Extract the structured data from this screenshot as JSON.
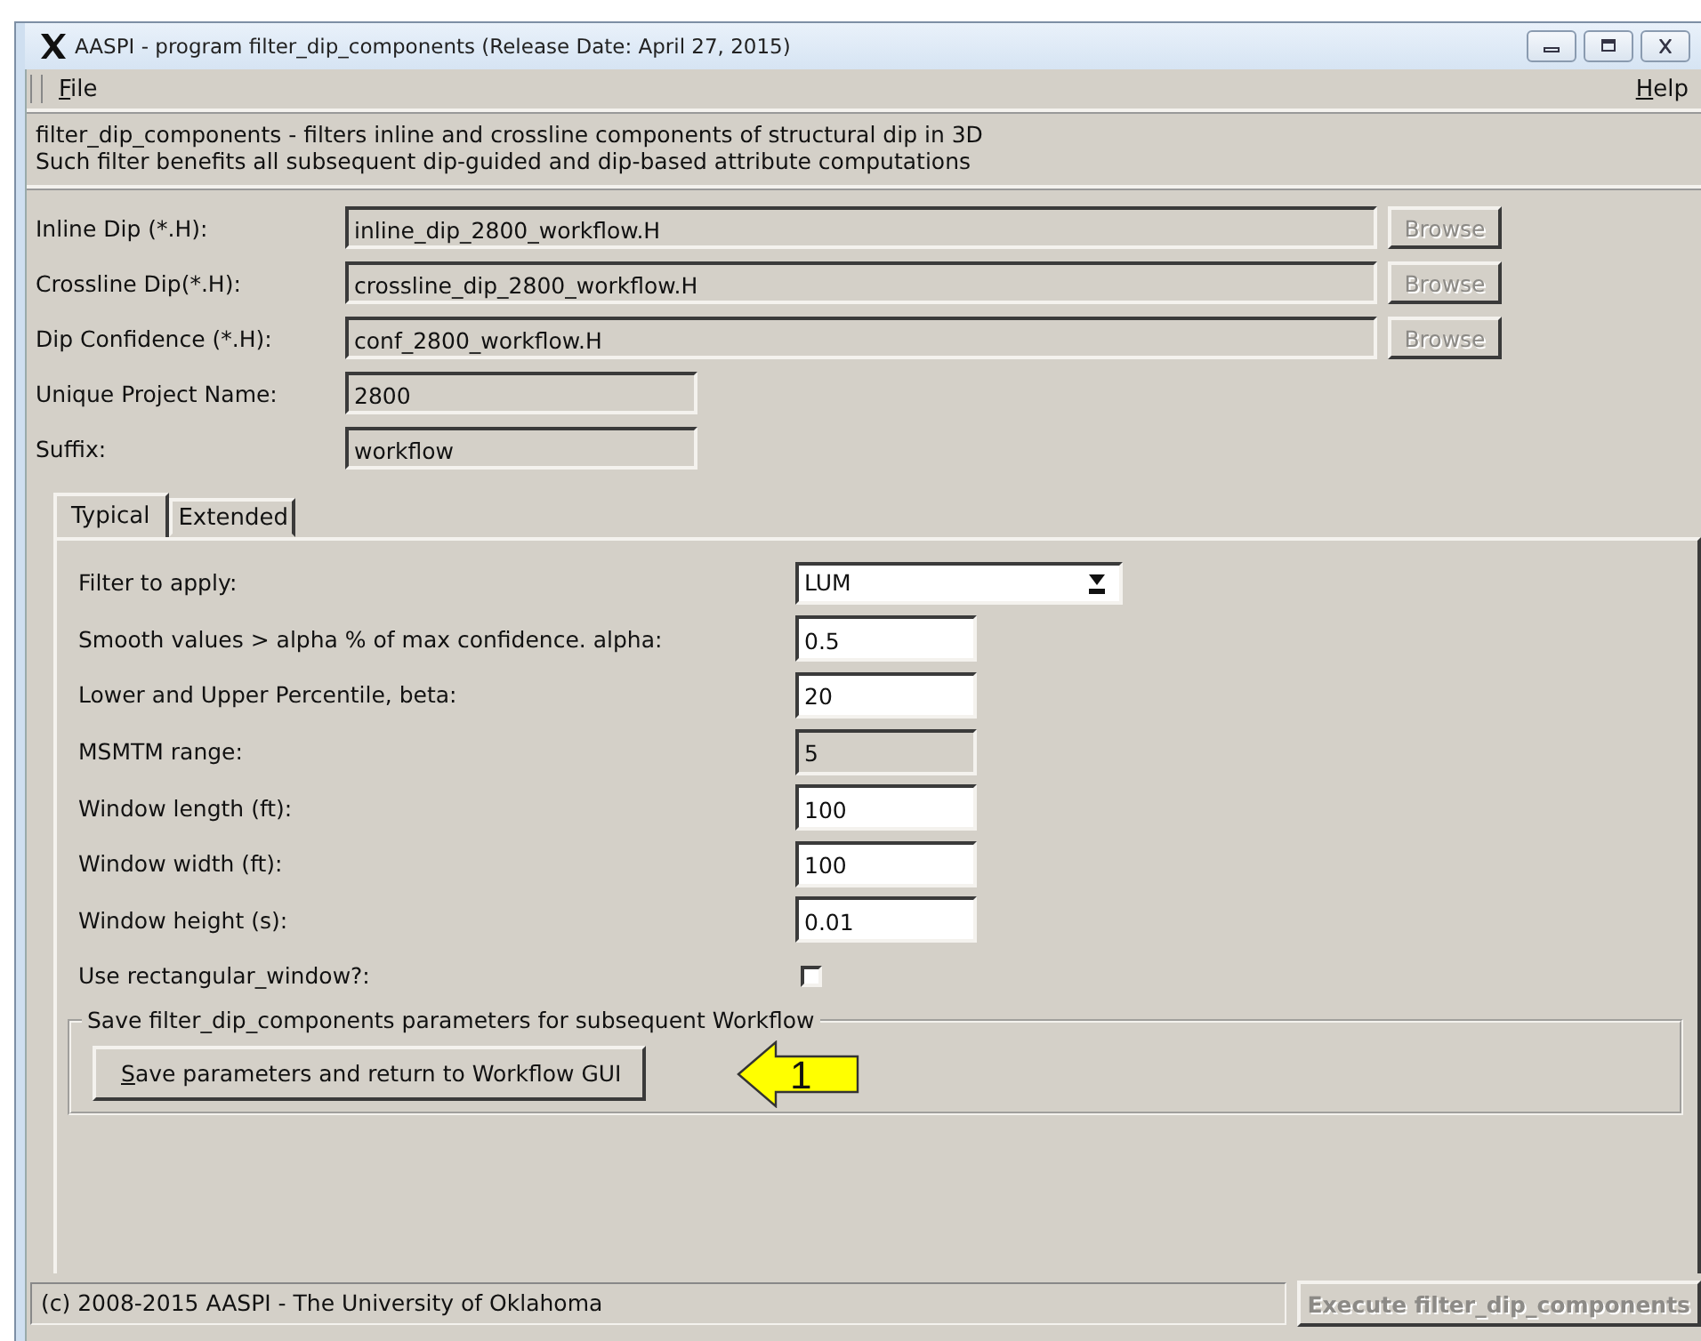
{
  "window": {
    "title": "AASPI - program filter_dip_components (Release Date: April 27, 2015)"
  },
  "menu_left": [
    {
      "label": "File",
      "underline_first": true
    }
  ],
  "menu_right": [
    {
      "label": "Help",
      "underline_first": true
    }
  ],
  "description": [
    "filter_dip_components - filters inline and crossline components of structural dip in 3D",
    "Such filter benefits all subsequent dip-guided and dip-based attribute computations"
  ],
  "files": [
    {
      "label": "Inline Dip (*.H):",
      "value": "inline_dip_2800_workflow.H",
      "button": "Browse",
      "wide": true
    },
    {
      "label": "Crossline Dip(*.H):",
      "value": "crossline_dip_2800_workflow.H",
      "button": "Browse",
      "wide": true
    },
    {
      "label": "Dip Confidence (*.H):",
      "value": "conf_2800_workflow.H",
      "button": "Browse",
      "wide": true
    },
    {
      "label": "Unique Project Name:",
      "value": "2800",
      "wide": false
    },
    {
      "label": "Suffix:",
      "value": "workflow",
      "wide": false
    }
  ],
  "tabs": [
    {
      "label": "Typical",
      "selected": true
    },
    {
      "label": "Extended",
      "selected": false
    }
  ],
  "params": [
    {
      "kind": "dropdown",
      "label": "Filter to apply:",
      "value": "LUM"
    },
    {
      "kind": "entry",
      "label": "Smooth values  > alpha % of max confidence. alpha:",
      "value": "0.5",
      "disabled": false
    },
    {
      "kind": "entry",
      "label": "Lower and Upper Percentile, beta:",
      "value": "20",
      "disabled": false
    },
    {
      "kind": "entry",
      "label": "MSMTM range:",
      "value": "5",
      "disabled": true
    },
    {
      "kind": "entry",
      "label": "Window length (ft):",
      "value": "100",
      "disabled": false
    },
    {
      "kind": "entry",
      "label": "Window width (ft):",
      "value": "100",
      "disabled": false
    },
    {
      "kind": "entry",
      "label": "Window height (s):",
      "value": "0.01",
      "disabled": false
    },
    {
      "kind": "checkbox",
      "label": "Use rectangular_window?:",
      "checked": false
    }
  ],
  "save_group": {
    "title": "Save filter_dip_components parameters for subsequent Workflow",
    "button": "Save parameters and return to Workflow GUI",
    "underline_first": true,
    "annotation": "1"
  },
  "status_bar": {
    "text": "(c) 2008-2015 AASPI - The University of Oklahoma",
    "button": "Execute filter_dip_components",
    "button_disabled": true
  }
}
